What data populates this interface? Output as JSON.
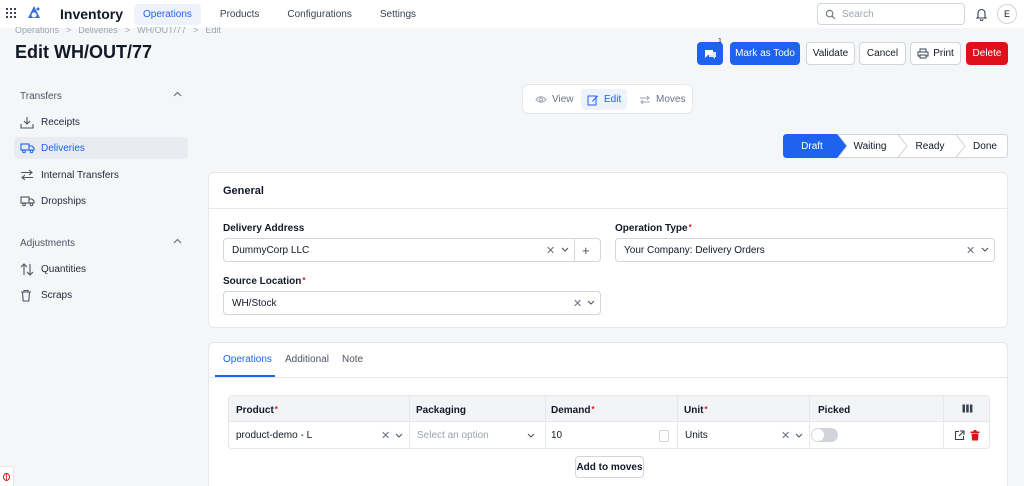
{
  "app": {
    "name": "Inventory"
  },
  "nav": {
    "items": [
      "Operations",
      "Products",
      "Configurations",
      "Settings"
    ]
  },
  "search": {
    "placeholder": "Search"
  },
  "user": {
    "initial": "E"
  },
  "breadcrumb": [
    "Operations",
    ">",
    "Deliveries",
    ">",
    "WH/OUT/77",
    ">",
    "Edit"
  ],
  "page": {
    "title": "Edit WH/OUT/77"
  },
  "actions": {
    "chat_badge": "1",
    "mark_todo": "Mark as Todo",
    "validate": "Validate",
    "cancel": "Cancel",
    "print": "Print",
    "delete": "Delete"
  },
  "sidebar": {
    "transfers_title": "Transfers",
    "items": [
      "Receipts",
      "Deliveries",
      "Internal Transfers",
      "Dropships"
    ],
    "adjustments_title": "Adjustments",
    "adjust_items": [
      "Quantities",
      "Scraps"
    ]
  },
  "view_switch": [
    "View",
    "Edit",
    "Moves"
  ],
  "status_steps": [
    "Draft",
    "Waiting",
    "Ready",
    "Done"
  ],
  "general": {
    "title": "General",
    "delivery_address_label": "Delivery Address",
    "delivery_address_value": "DummyCorp LLC",
    "operation_type_label": "Operation Type",
    "operation_type_value": "Your Company: Delivery Orders",
    "source_location_label": "Source Location",
    "source_location_value": "WH/Stock"
  },
  "tabs": [
    "Operations",
    "Additional",
    "Note"
  ],
  "moves_table": {
    "headers": [
      "Product",
      "Packaging",
      "Demand",
      "Unit",
      "Picked"
    ],
    "row": {
      "product": "product-demo - L",
      "packaging_placeholder": "Select an option",
      "demand": "10",
      "unit": "Units"
    },
    "add_label": "Add to moves"
  },
  "colors": {
    "accent": "#1d63f0",
    "danger": "#e0101a"
  }
}
